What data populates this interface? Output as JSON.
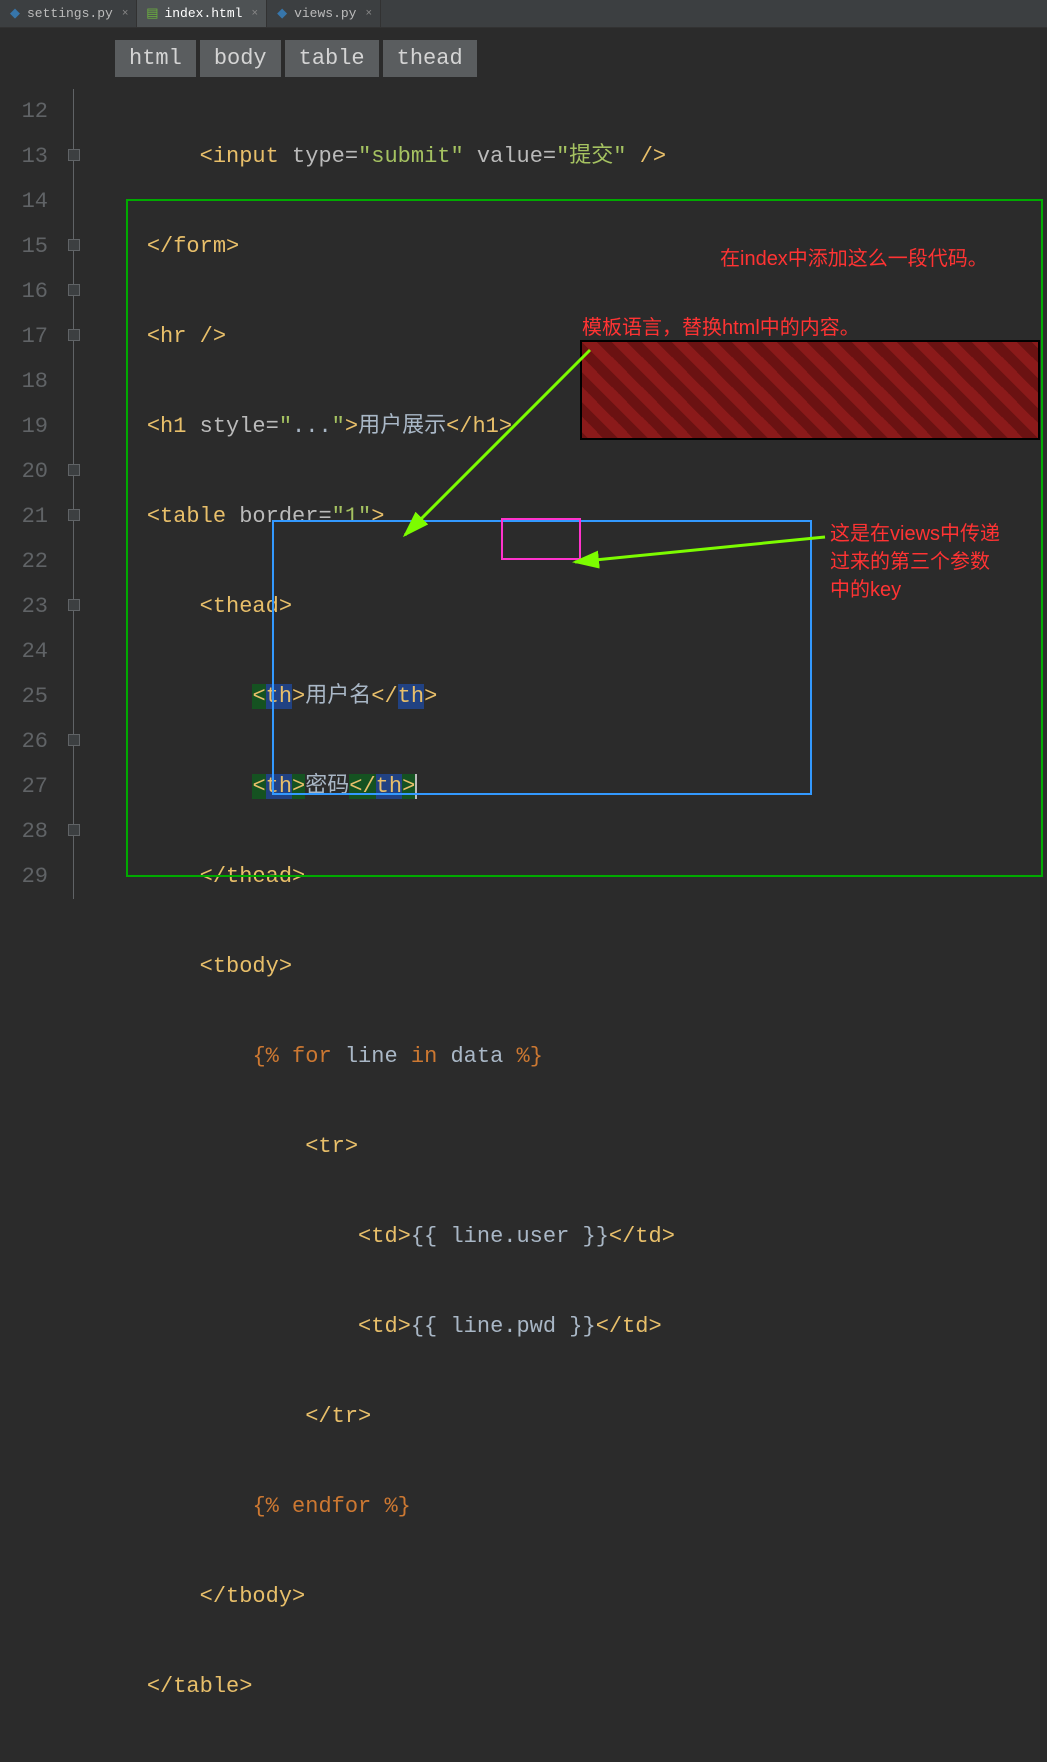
{
  "tabs": [
    {
      "name": "settings.py",
      "active": false,
      "type": "py"
    },
    {
      "name": "index.html",
      "active": true,
      "type": "html"
    },
    {
      "name": "views.py",
      "active": false,
      "type": "py"
    }
  ],
  "breadcrumbs": [
    "html",
    "body",
    "table",
    "thead"
  ],
  "line_numbers": [
    "12",
    "13",
    "14",
    "15",
    "16",
    "17",
    "18",
    "19",
    "20",
    "21",
    "22",
    "23",
    "24",
    "25",
    "26",
    "27",
    "28",
    "29"
  ],
  "code": {
    "l12_input": "<input type=\"submit\" value=\"提交\" />",
    "l13_form_close": "</form>",
    "l14_hr": "<hr />",
    "l15_h1_open": "<h1 style=\"",
    "l15_h1_style": "...",
    "l15_h1_mid": "\">",
    "l15_h1_text": "用户展示",
    "l15_h1_close": "</h1>",
    "l16_table": "<table border=\"1\">",
    "l17_thead": "<thead>",
    "l18_th_open": "<th>",
    "l18_th_text": "用户名",
    "l18_th_close": "</th>",
    "l19_th_open": "<th>",
    "l19_th_text": "密码",
    "l19_th_close": "</th>",
    "l20_thead_close": "</thead>",
    "l21_tbody": "<tbody>",
    "l22_for_open": "{% ",
    "l22_for": "for",
    "l22_line": " line ",
    "l22_in": "in",
    "l22_data": " data ",
    "l22_for_close": "%}",
    "l23_tr": "<tr>",
    "l24_td_open": "<td>",
    "l24_expr": "{{ line.user }}",
    "l24_td_close": "</td>",
    "l25_td_open": "<td>",
    "l25_expr": "{{ line.pwd }}",
    "l25_td_close": "</td>",
    "l26_tr_close": "</tr>",
    "l27_endfor": "{% endfor %}",
    "l28_tbody_close": "</tbody>",
    "l29_table_close": "</table>"
  },
  "annotations": {
    "top_right": "在index中添加这么一段代码。",
    "mid": "模板语言，替换html中的内容。",
    "right1": "这是在views中传递",
    "right2": "过来的第三个参数",
    "right3": "中的key"
  }
}
